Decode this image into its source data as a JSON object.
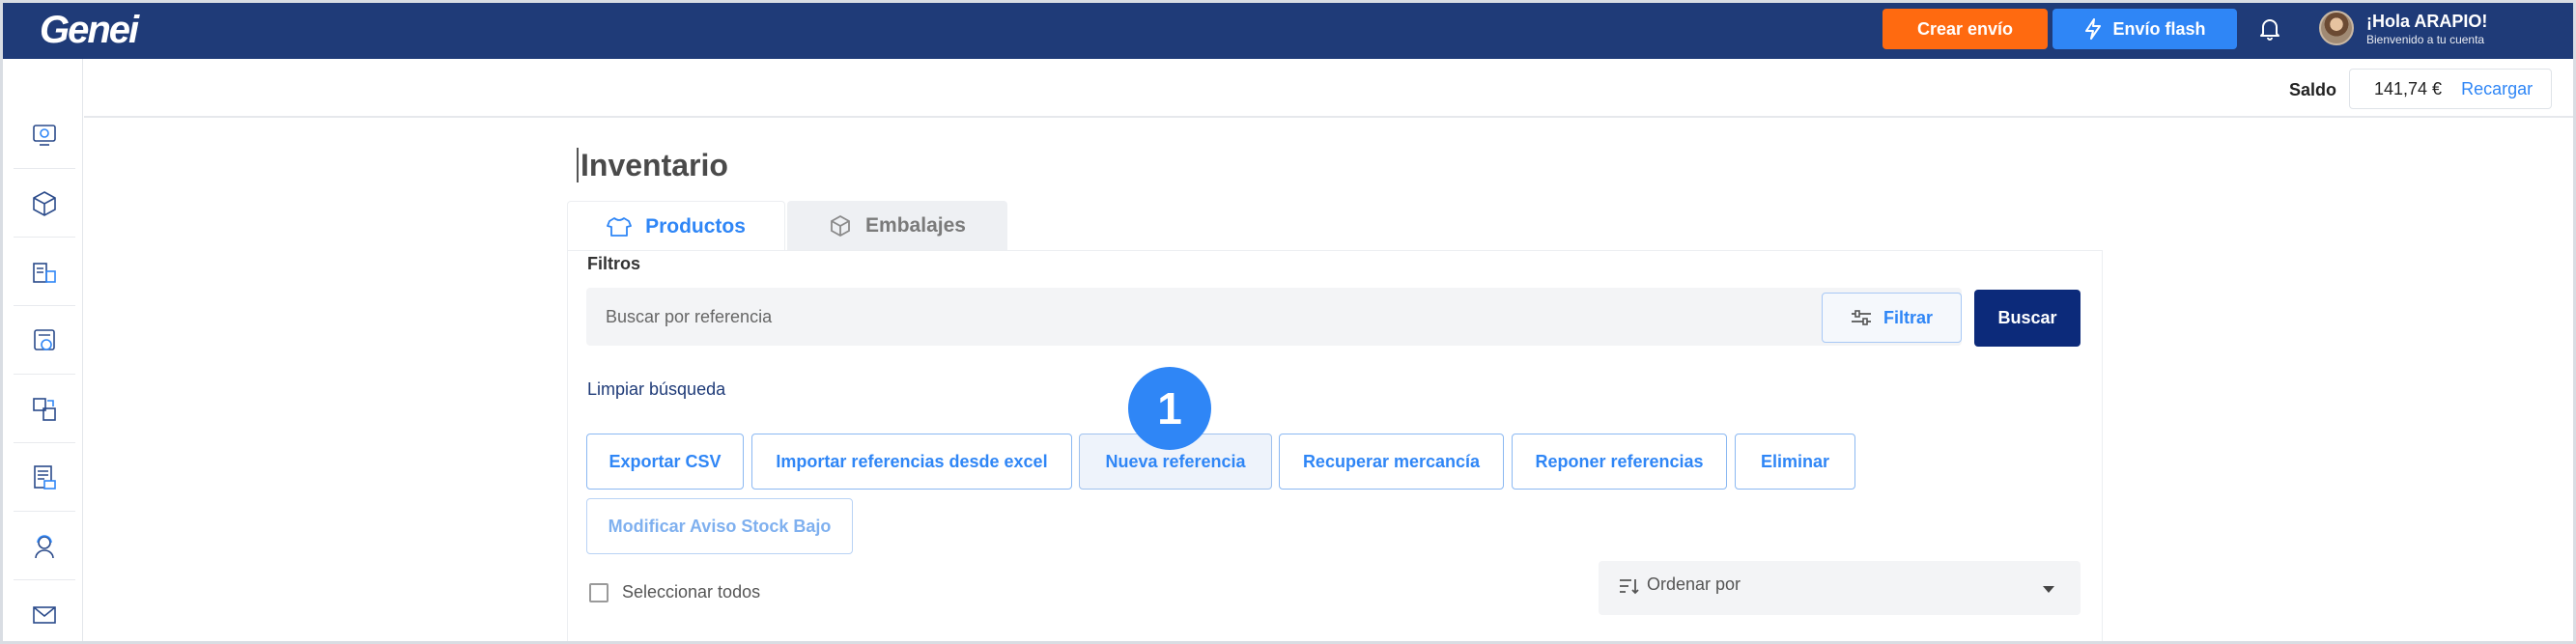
{
  "app": {
    "logo": "Genei"
  },
  "header": {
    "create_label": "Crear envío",
    "flash_label": "Envío flash",
    "greeting": "¡Hola ARAPIO!",
    "greeting_sub": "Bienvenido a tu cuenta"
  },
  "sidebar": {
    "items": [
      {
        "icon": "dashboard-icon"
      },
      {
        "icon": "box-icon"
      },
      {
        "icon": "shipments-icon"
      },
      {
        "icon": "tracking-icon"
      },
      {
        "icon": "inventory-icon"
      },
      {
        "icon": "invoice-icon"
      },
      {
        "icon": "support-agent-icon"
      },
      {
        "icon": "mail-icon"
      }
    ]
  },
  "balance": {
    "label": "Saldo",
    "amount": "141,74 €",
    "recharge": "Recargar"
  },
  "page": {
    "title": "Inventario"
  },
  "tabs": [
    {
      "label": "Productos",
      "active": true,
      "icon": "tshirt-icon"
    },
    {
      "label": "Embalajes",
      "active": false,
      "icon": "package-icon"
    }
  ],
  "filters": {
    "label": "Filtros",
    "search_placeholder": "Buscar por referencia",
    "filter_button": "Filtrar",
    "search_button": "Buscar",
    "clear": "Limpiar búsqueda"
  },
  "actions": [
    {
      "label": "Exportar CSV"
    },
    {
      "label": "Importar referencias desde excel"
    },
    {
      "label": "Nueva referencia"
    },
    {
      "label": "Recuperar mercancía"
    },
    {
      "label": "Reponer referencias"
    },
    {
      "label": "Eliminar"
    },
    {
      "label": "Modificar Aviso Stock Bajo"
    }
  ],
  "step_badge": "1",
  "list": {
    "select_all": "Seleccionar todos",
    "order_by": "Ordenar por"
  },
  "colors": {
    "topbar": "#1f3b78",
    "create": "#ff6a10",
    "flash": "#2f86f6",
    "primary_dark": "#0c2a7a"
  }
}
